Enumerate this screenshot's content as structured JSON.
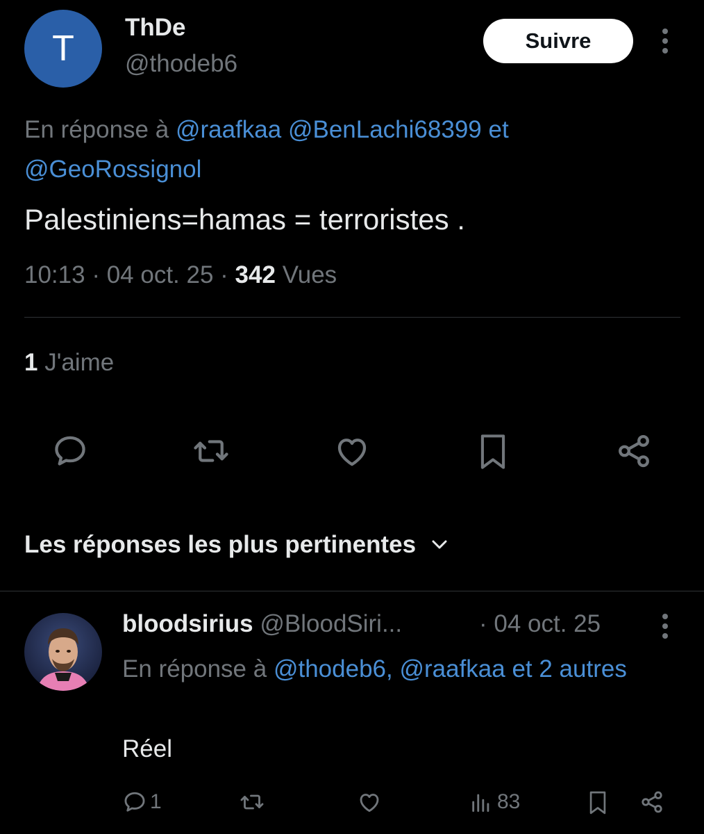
{
  "tweet": {
    "avatar_letter": "T",
    "display_name": "ThDe",
    "handle": "@thodeb6",
    "follow_label": "Suivre",
    "reply_prefix": "En réponse à",
    "reply_mentions": "@raafkaa @BenLachi68399 et @GeoRossignol",
    "text": "Palestiniens=hamas = terroristes .",
    "time": "10:13",
    "date": "04 oct. 25",
    "views_count": "342",
    "views_label": "Vues",
    "likes_count": "1",
    "likes_label": "J'aime"
  },
  "sort_label": "Les réponses les plus pertinentes",
  "reply": {
    "display_name": "bloodsirius",
    "handle": "@BloodSiri...",
    "date": "· 04 oct. 25",
    "reply_prefix": "En réponse à",
    "reply_mentions": "@thodeb6, @raafkaa et 2 autres",
    "text": "Réel",
    "reply_count": "1",
    "views_count": "83"
  },
  "colors": {
    "background": "#000000",
    "text": "#e7e9ea",
    "muted": "#71767b",
    "link": "#4a8fd6",
    "avatar": "#2a5fa8"
  }
}
